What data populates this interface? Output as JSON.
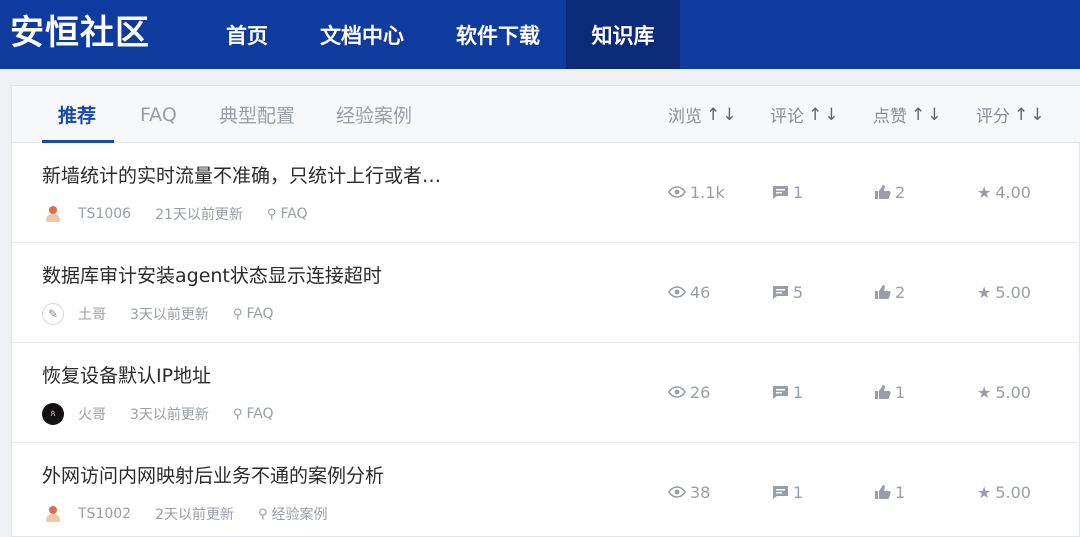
{
  "brand": "安恒社区",
  "nav": [
    "首页",
    "文档中心",
    "软件下载",
    "知识库"
  ],
  "tabs": [
    "推荐",
    "FAQ",
    "典型配置",
    "经验案例"
  ],
  "sorts": [
    "浏览",
    "评论",
    "点赞",
    "评分"
  ],
  "sort_arrows": "↑↓",
  "rows": [
    {
      "title": "新墙统计的实时流量不准确，只统计上行或者…",
      "user": "TS1006",
      "updated": "21天以前更新",
      "category": "FAQ",
      "views": "1.1k",
      "comments": "1",
      "likes": "2",
      "rating": "4.00",
      "avatar": "ts"
    },
    {
      "title": "数据库审计安装agent状态显示连接超时",
      "user": "土哥",
      "updated": "3天以前更新",
      "category": "FAQ",
      "views": "46",
      "comments": "5",
      "likes": "2",
      "rating": "5.00",
      "avatar": "sketch"
    },
    {
      "title": "恢复设备默认IP地址",
      "user": "火哥",
      "updated": "3天以前更新",
      "category": "FAQ",
      "views": "26",
      "comments": "1",
      "likes": "1",
      "rating": "5.00",
      "avatar": "dark"
    },
    {
      "title": "外网访问内网映射后业务不通的案例分析",
      "user": "TS1002",
      "updated": "2天以前更新",
      "category": "经验案例",
      "views": "38",
      "comments": "1",
      "likes": "1",
      "rating": "5.00",
      "avatar": "ts"
    }
  ],
  "colors": {
    "nav_bg": "#0f3a9e",
    "nav_active": "#0b2b78",
    "accent": "#1b49a8"
  }
}
